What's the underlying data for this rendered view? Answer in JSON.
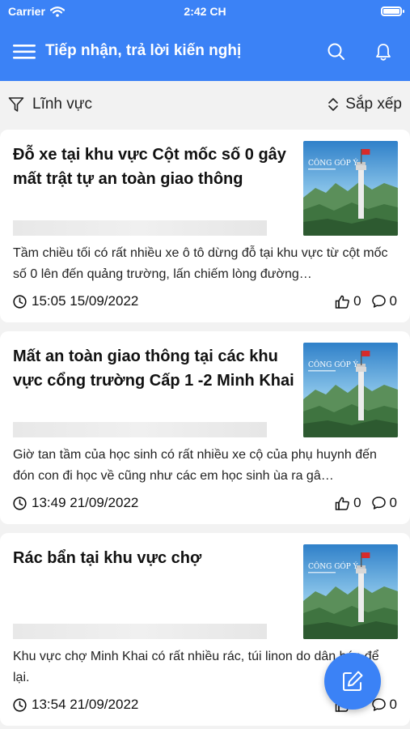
{
  "status_bar": {
    "carrier": "Carrier",
    "time": "2:42 CH"
  },
  "header": {
    "title": "Tiếp nhận, trả lời kiến nghị"
  },
  "filter": {
    "field_label": "Lĩnh vực",
    "sort_label": "Sắp xếp"
  },
  "colors": {
    "primary": "#3b82f6",
    "background": "#f2f2f2",
    "card": "#ffffff"
  },
  "thumbnail": {
    "caption": "CÔNG GÓP Ý"
  },
  "posts": [
    {
      "title": "Đỗ xe tại khu vực Cột mốc số 0 gây mất trật tự an toàn giao thông",
      "excerpt": "Tầm chiều tối có rất nhiều xe ô tô dừng đỗ tại khu vực từ cột mốc số 0 lên đến quảng trường, lấn chiếm lòng đường…",
      "datetime": "15:05 15/09/2022",
      "likes": "0",
      "comments": "0"
    },
    {
      "title": "Mất an toàn giao thông tại các khu vực cổng trường Cấp 1 -2 Minh Khai",
      "excerpt": "Giờ tan tầm của học sinh có rất nhiều xe cộ của phụ huynh đến đón con đi học về cũng như các em học sinh ùa ra gâ…",
      "datetime": "13:49 21/09/2022",
      "likes": "0",
      "comments": "0"
    },
    {
      "title": "Rác bẩn tại khu vực chợ",
      "excerpt": "Khu vực chợ Minh Khai có rất nhiều rác, túi linon do dân bán để lại.",
      "datetime": "13:54 21/09/2022",
      "likes": "0",
      "comments": "0"
    }
  ]
}
